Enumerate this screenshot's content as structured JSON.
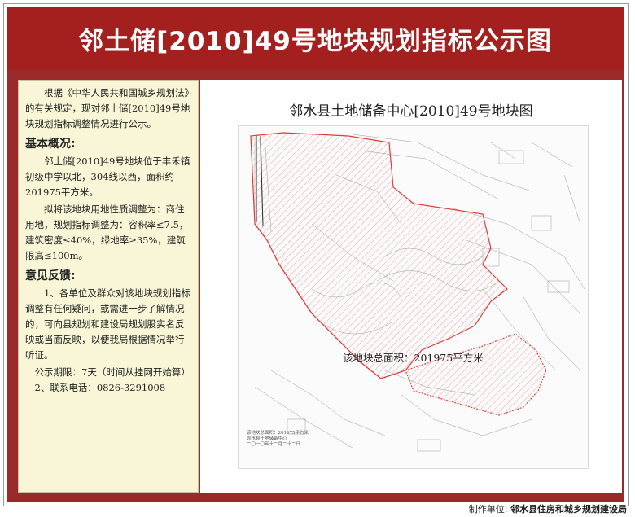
{
  "title": "邻土储[2010]49号地块规划指标公示图",
  "notice": {
    "intro": "根据《中华人民共和国城乡规划法》的有关规定，现对邻土储[2010]49号地块规划指标调整情况进行公示。",
    "overview_heading": "基本概况:",
    "overview_lines": [
      "邻土储[2010]49号地块位于丰禾镇初级中学以北，304线以西，面积约201975平方米。",
      "拟将该地块用地性质调整为：商住用地，规划指标调整为：容积率≤7.5，建筑密度≤40%，绿地率≥35%，建筑限高≤100m。"
    ],
    "feedback_heading": "意见反馈:",
    "feedback_lines": [
      "1、各单位及群众对该地块规划指标调整有任何疑问，或需进一步了解情况的，可向县规划和建设局规划股实名反映或当面反映，以便我局根据情况举行听证。",
      "公示期限：7天（时间从挂网开始算）",
      "2、联系电话：0826-3291008"
    ]
  },
  "map": {
    "title": "邻水县土地储备中心[2010]49号地块图",
    "area_label": "该地块总面积：201975平方米",
    "boundary_color": "#e03c3c",
    "legend_note": [
      "该地块总面积：201975平方米",
      "邻水县土地储备中心",
      "二〇一〇年十二月二十二日"
    ]
  },
  "footer": {
    "label": "制作单位:",
    "org": "邻水县住房和城乡规划建设局"
  }
}
